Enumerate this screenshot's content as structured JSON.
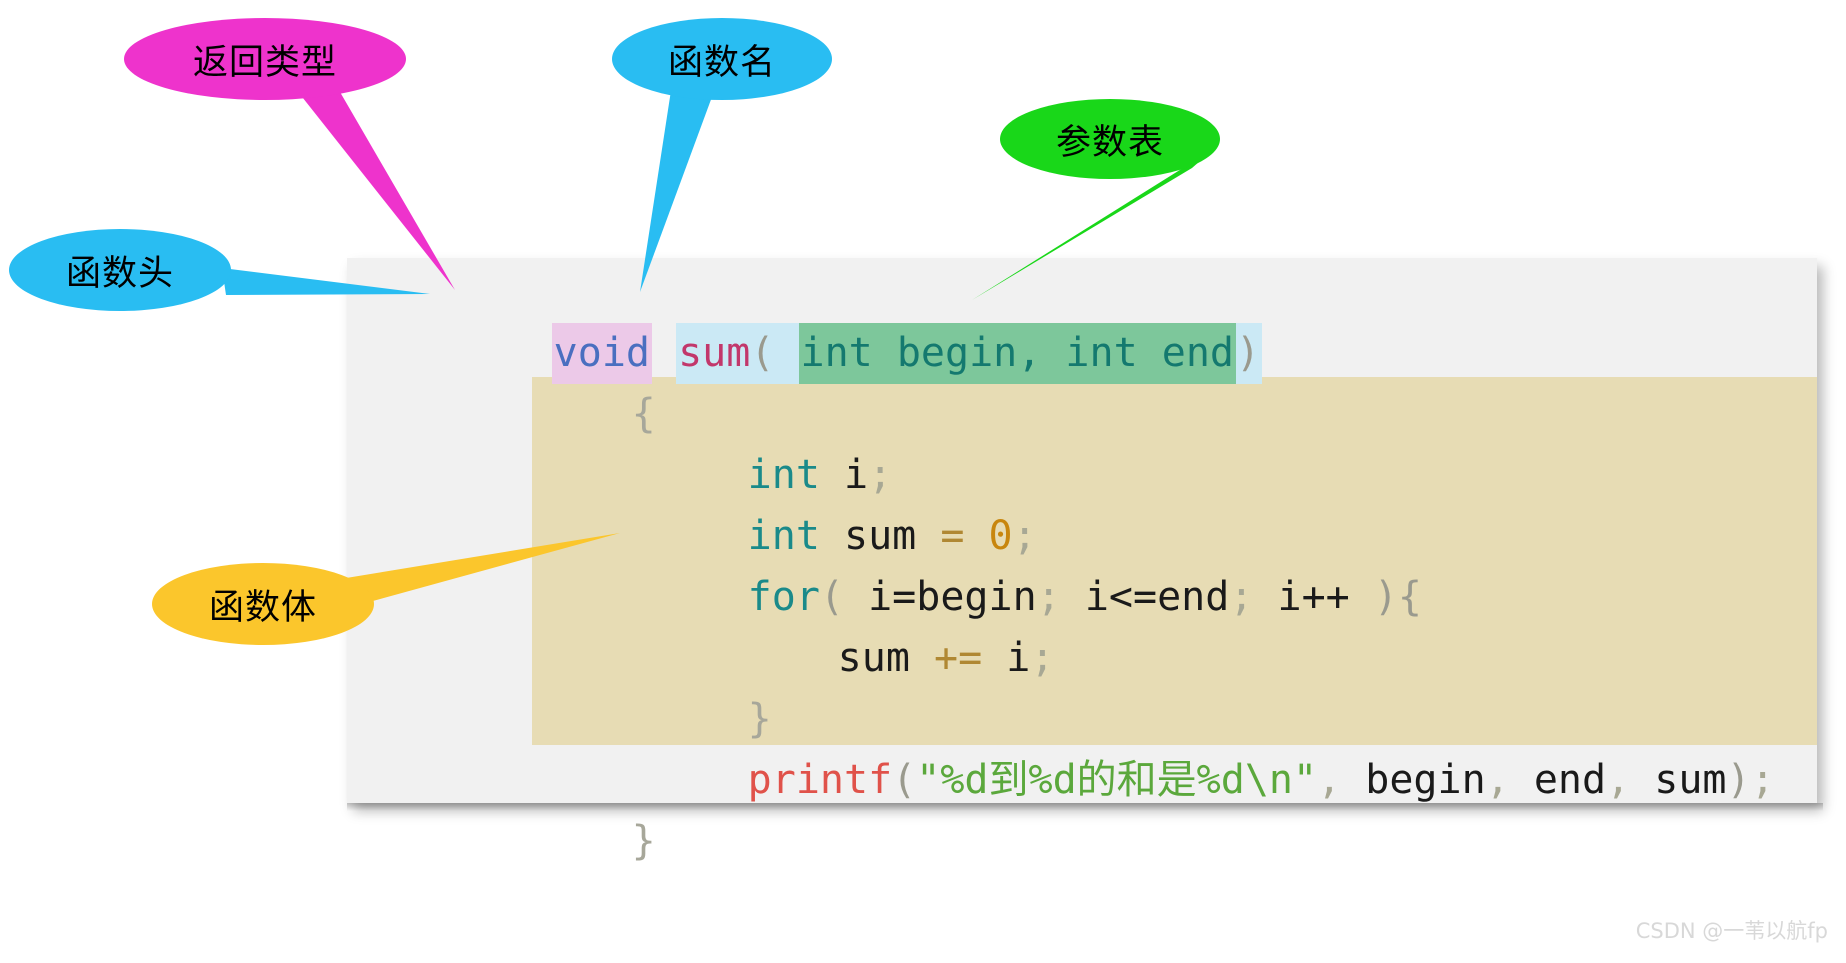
{
  "code": {
    "panel_background": "#f1f1f1",
    "body_highlight_background": "#e7dcb4",
    "signature": {
      "return_type": "void",
      "space_after_return": " ",
      "func_name": "sum",
      "open_paren": "(",
      "space_inside": " ",
      "params": "int begin, int end",
      "close_paren": ")"
    },
    "open_brace": "{",
    "lines": {
      "decl_i_type": "int",
      "decl_i_name": " i",
      "decl_i_semi": ";",
      "decl_sum_type": "int",
      "decl_sum_name": " sum ",
      "decl_sum_eq": "=",
      "decl_sum_value": " 0",
      "decl_sum_semi": ";",
      "for_kw": "for",
      "for_open": "( ",
      "for_init": "i=begin",
      "for_semi1": "; ",
      "for_cond": "i<=end",
      "for_semi2": "; ",
      "for_incr": "i++",
      "for_close": " ){",
      "sum_stmt_name": "sum ",
      "sum_stmt_op": "+=",
      "sum_stmt_arg": " i",
      "sum_stmt_semi": ";",
      "for_close_brace": "}",
      "printf_name": "printf",
      "printf_open": "(",
      "printf_string": "\"%d到%d的和是%d\\n\"",
      "printf_comma1": ", ",
      "printf_arg1": "begin",
      "printf_comma2": ", ",
      "printf_arg2": "end",
      "printf_comma3": ", ",
      "printf_arg3": "sum",
      "printf_close": ")",
      "printf_semi": ";"
    },
    "close_brace": "}"
  },
  "callouts": [
    {
      "id": "return-type",
      "label": "返回类型",
      "color": "#ee33cc",
      "points_to": "void"
    },
    {
      "id": "function-name",
      "label": "函数名",
      "color": "#29bdf2",
      "points_to": "sum"
    },
    {
      "id": "parameter-list",
      "label": "参数表",
      "color": "#19d719",
      "points_to": "int begin, int end"
    },
    {
      "id": "function-header",
      "label": "函数头",
      "color": "#29bdf2",
      "points_to": "void sum( int begin, int end)"
    },
    {
      "id": "function-body",
      "label": "函数体",
      "color": "#fbc62c",
      "points_to": "body block"
    }
  ],
  "watermark": {
    "text": "CSDN @一苇以航fp"
  }
}
